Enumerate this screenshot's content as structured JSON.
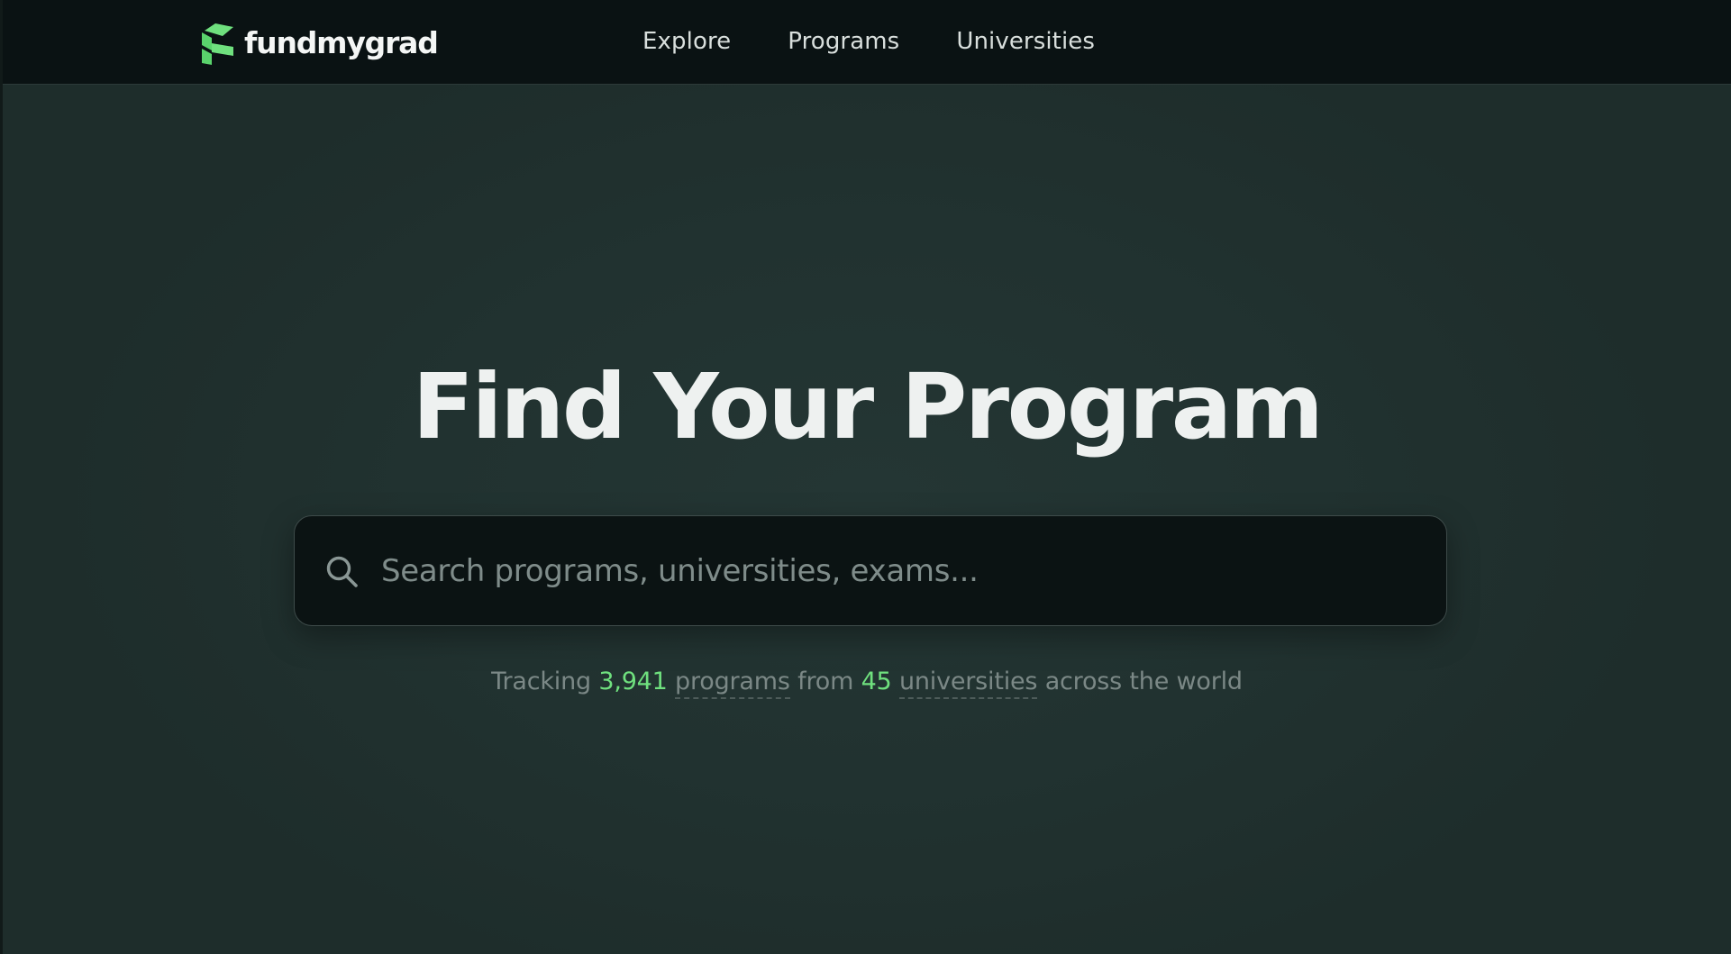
{
  "brand": {
    "name": "fundmygrad",
    "logo_icon": "fundmygrad-logo-icon",
    "accent_color": "#6fe07e"
  },
  "nav": {
    "links": [
      {
        "label": "Explore"
      },
      {
        "label": "Programs"
      },
      {
        "label": "Universities"
      }
    ]
  },
  "hero": {
    "title": "Find Your Program"
  },
  "search": {
    "placeholder": "Search programs, universities, exams...",
    "value": "",
    "icon": "search-icon"
  },
  "stats": {
    "prefix": "Tracking",
    "program_count": "3,941",
    "programs_label": "programs",
    "connector": "from",
    "university_count": "45",
    "universities_label": "universities",
    "suffix": "across the world"
  }
}
